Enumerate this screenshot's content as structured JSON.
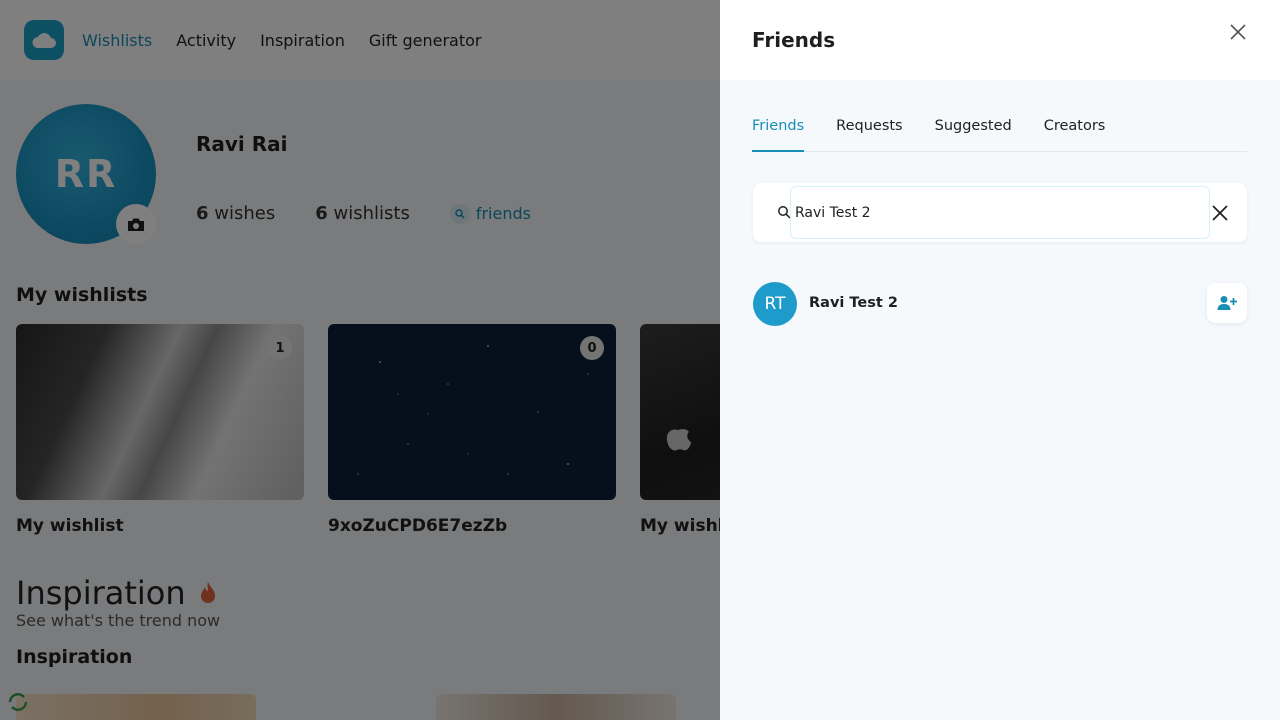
{
  "nav": {
    "logo_icon": "cloud-icon",
    "items": [
      {
        "label": "Wishlists",
        "active": true
      },
      {
        "label": "Activity",
        "active": false
      },
      {
        "label": "Inspiration",
        "active": false
      },
      {
        "label": "Gift generator",
        "active": false
      }
    ]
  },
  "profile": {
    "initials": "RR",
    "name": "Ravi Rai",
    "wishes_count": "6",
    "wishes_label": "wishes",
    "wishlists_count": "6",
    "wishlists_label": "wishlists",
    "friends_label": "friends"
  },
  "my_wishlists": {
    "title": "My wishlists",
    "cards": [
      {
        "title": "My wishlist",
        "count": "1"
      },
      {
        "title": "9xoZuCPD6E7ezZb",
        "count": "0"
      },
      {
        "title": "My wishli",
        "count": ""
      }
    ]
  },
  "inspiration": {
    "heading": "Inspiration",
    "subtitle": "See what's the trend now",
    "section_title": "Inspiration"
  },
  "drawer": {
    "title": "Friends",
    "tabs": [
      "Friends",
      "Requests",
      "Suggested",
      "Creators"
    ],
    "active_tab": "Friends",
    "search_value": "Ravi Test 2",
    "results": [
      {
        "initials": "RT",
        "name": "Ravi Test 2"
      }
    ]
  },
  "colors": {
    "accent": "#178fb3",
    "avatar": "#1e9bcb",
    "drawer_bg": "#f5f9fc"
  }
}
